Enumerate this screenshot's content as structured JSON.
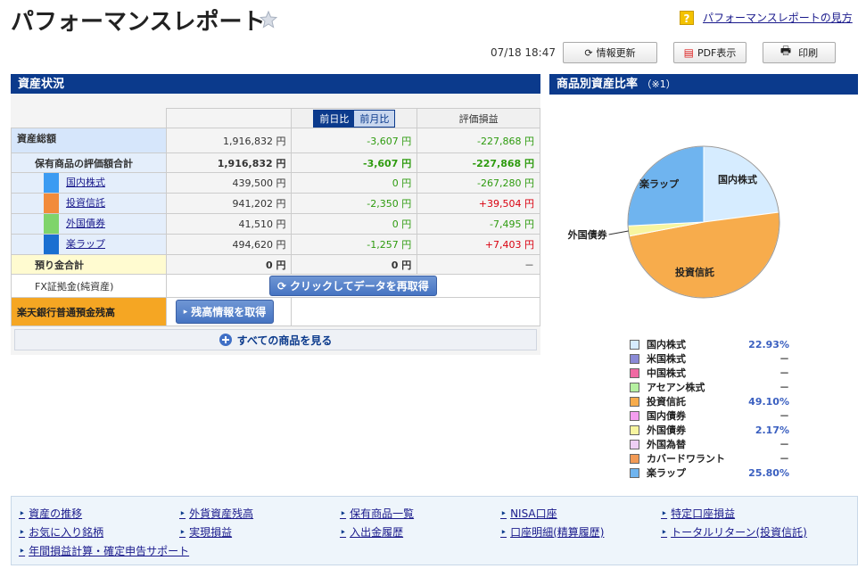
{
  "header": {
    "title": "パフォーマンスレポート",
    "help_label": "パフォーマンスレポートの見方",
    "help_icon": "?"
  },
  "toolbar": {
    "timestamp": "07/18 18:47",
    "refresh_label": "情報更新",
    "pdf_label": "PDF表示",
    "print_label": "印刷"
  },
  "asset_panel": {
    "title": "資産状況",
    "tab_day": "前日比",
    "tab_month": "前月比",
    "col_pl": "評価損益",
    "total": {
      "label": "資産総額",
      "value": "1,916,832 円",
      "diff": "-3,607 円",
      "pl": "-227,868 円"
    },
    "holdings": {
      "label": "保有商品の評価額合計",
      "value": "1,916,832 円",
      "diff": "-3,607 円",
      "pl": "-227,868 円"
    },
    "rows": [
      {
        "name": "国内株式",
        "value": "439,500 円",
        "diff": "0 円",
        "pl": "-267,280 円",
        "color": "#3b9bf2"
      },
      {
        "name": "投資信託",
        "value": "941,202 円",
        "diff": "-2,350 円",
        "pl": "+39,504 円",
        "color": "#f28b3b"
      },
      {
        "name": "外国債券",
        "value": "41,510 円",
        "diff": "0 円",
        "pl": "-7,495 円",
        "color": "#7fd46b"
      },
      {
        "name": "楽ラップ",
        "value": "494,620 円",
        "diff": "-1,257 円",
        "pl": "+7,403 円",
        "color": "#1a6fd1"
      }
    ],
    "deposit": {
      "label": "預り金合計",
      "value": "0 円",
      "diff": "0 円",
      "pl": "－"
    },
    "fx": {
      "label": "FX証拠金(純資産)",
      "button": "クリックしてデータを再取得"
    },
    "bank": {
      "label": "楽天銀行普通預金残高",
      "button": "残高情報を取得"
    },
    "show_all": "すべての商品を見る"
  },
  "ratio_panel": {
    "title": "商品別資産比率",
    "note": "（※1）",
    "pie_labels": {
      "domestic": "国内株式",
      "fund": "投資信託",
      "bond": "外国債券",
      "wrap": "楽ラップ"
    }
  },
  "chart_data": {
    "type": "pie",
    "slices": [
      {
        "name": "国内株式",
        "value": 22.93,
        "color": "#d6ecff"
      },
      {
        "name": "米国株式",
        "value": 0,
        "color": "#8a8ad6"
      },
      {
        "name": "中国株式",
        "value": 0,
        "color": "#f06aa3"
      },
      {
        "name": "アセアン株式",
        "value": 0,
        "color": "#b5f0a0"
      },
      {
        "name": "投資信託",
        "value": 49.1,
        "color": "#f7ac4c"
      },
      {
        "name": "国内債券",
        "value": 0,
        "color": "#f59ef0"
      },
      {
        "name": "外国債券",
        "value": 2.17,
        "color": "#f7f5a0"
      },
      {
        "name": "外国為替",
        "value": 0,
        "color": "#eecff5"
      },
      {
        "name": "カバードワラント",
        "value": 0,
        "color": "#f29a55"
      },
      {
        "name": "楽ラップ",
        "value": 25.8,
        "color": "#6fb4ef"
      }
    ],
    "legend_values": [
      "22.93%",
      "－",
      "－",
      "－",
      "49.10%",
      "－",
      "2.17%",
      "－",
      "－",
      "25.80%"
    ]
  },
  "footer_links": [
    "資産の推移",
    "外貨資産残高",
    "保有商品一覧",
    "NISA口座",
    "特定口座損益",
    "お気に入り銘柄",
    "実現損益",
    "入出金履歴",
    "口座明細(精算履歴)",
    "トータルリターン(投資信託)",
    "年間損益計算・確定申告サポート"
  ]
}
